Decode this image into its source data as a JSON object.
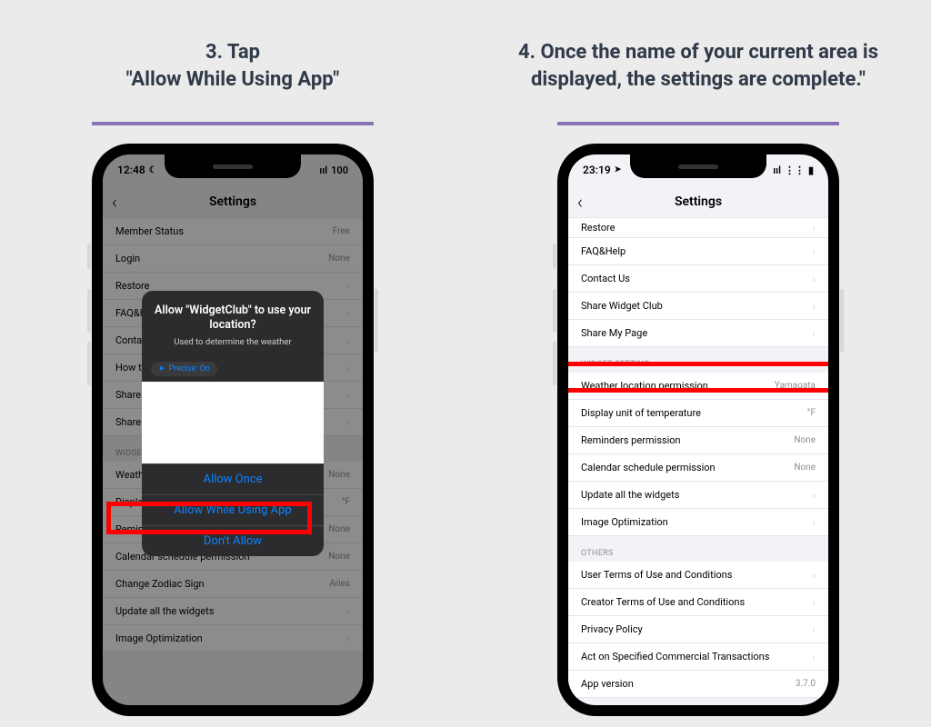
{
  "left": {
    "heading": "3. Tap\n\"Allow While Using App\"",
    "status_time": "12:48",
    "moon_glyph": "☾",
    "signal_glyph": "ııl",
    "battery_glyph": "100",
    "nav_title": "Settings",
    "back_glyph": "‹",
    "rows": [
      {
        "label": "Member Status",
        "value": "Free"
      },
      {
        "label": "Login",
        "value": "None"
      },
      {
        "label": "Restore",
        "value": ""
      },
      {
        "label": "FAQ&Help",
        "value": ""
      },
      {
        "label": "Contact Us",
        "value": ""
      },
      {
        "label": "How to set widget",
        "value": ""
      },
      {
        "label": "Share Widget Club",
        "value": ""
      },
      {
        "label": "Share My Page",
        "value": ""
      }
    ],
    "section_widget": "WIDGET SETTING",
    "rows2": [
      {
        "label": "Weather location permission",
        "value": "None"
      },
      {
        "label": "Display unit of temperature",
        "value": "°F"
      },
      {
        "label": "Reminders permission",
        "value": "None"
      },
      {
        "label": "Calendar schedule permission",
        "value": "None"
      },
      {
        "label": "Change Zodiac Sign",
        "value": "Aries"
      },
      {
        "label": "Update all the widgets",
        "value": ""
      },
      {
        "label": "Image Optimization",
        "value": ""
      }
    ],
    "sheet": {
      "title": "Allow \"WidgetClub\" to use your location?",
      "subtitle": "Used to determine the weather",
      "precise_arrow": "➤",
      "precise": "Precise: On",
      "allow_once": "Allow Once",
      "allow_while": "Allow While Using App",
      "dont_allow": "Don't Allow"
    }
  },
  "right": {
    "heading": "4. Once the name of your current area is displayed, the settings are complete.\"",
    "status_time": "23:19",
    "loc_arrow": "➤",
    "signal_glyph": "ııl",
    "wifi_glyph": "⋮⋮",
    "battery_glyph": "▮",
    "nav_title": "Settings",
    "back_glyph": "‹",
    "rows_top": [
      {
        "label": "Restore",
        "value": ""
      },
      {
        "label": "FAQ&Help",
        "value": ""
      },
      {
        "label": "Contact Us",
        "value": ""
      },
      {
        "label": "Share Widget Club",
        "value": ""
      },
      {
        "label": "Share My Page",
        "value": ""
      }
    ],
    "section_widget": "WIDGET SETTING",
    "rows_widget": [
      {
        "label": "Weather location permission",
        "value": "Yamagata"
      },
      {
        "label": "Display unit of temperature",
        "value": "°F"
      },
      {
        "label": "Reminders permission",
        "value": "None"
      },
      {
        "label": "Calendar schedule permission",
        "value": "None"
      },
      {
        "label": "Update all the widgets",
        "value": ""
      },
      {
        "label": "Image Optimization",
        "value": ""
      }
    ],
    "section_others": "OTHERS",
    "rows_others": [
      {
        "label": "User Terms of Use and Conditions",
        "value": ""
      },
      {
        "label": "Creator Terms of Use and Conditions",
        "value": ""
      },
      {
        "label": "Privacy Policy",
        "value": ""
      },
      {
        "label": "Act on Specified Commercial Transactions",
        "value": ""
      },
      {
        "label": "App version",
        "value": "3.7.0"
      }
    ]
  }
}
